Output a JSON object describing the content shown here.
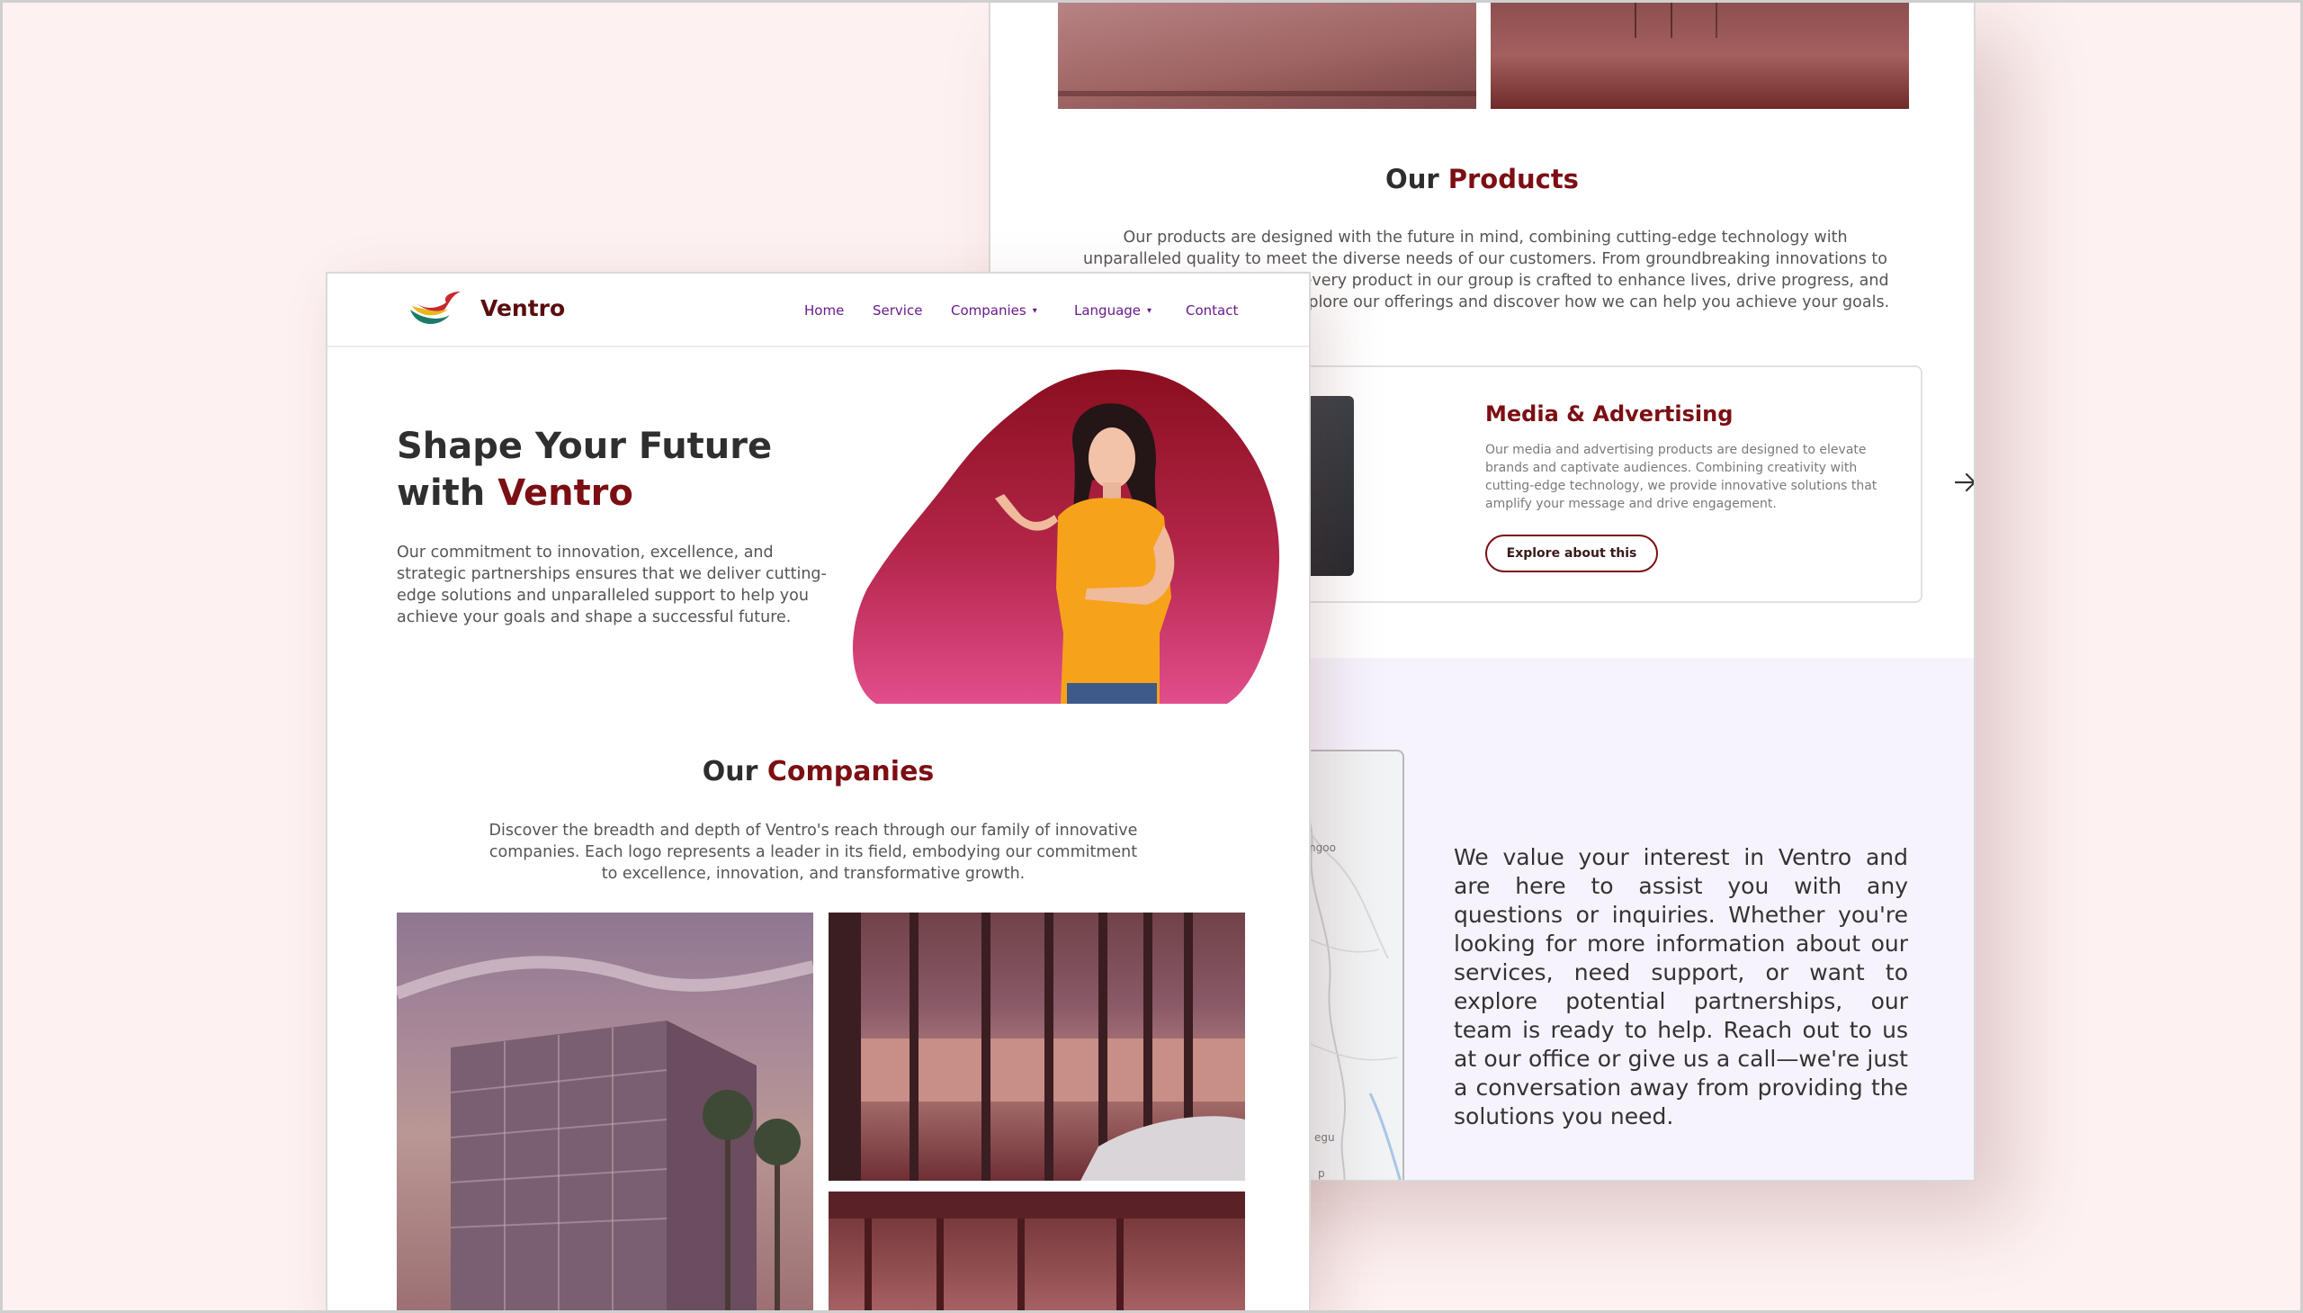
{
  "colors": {
    "background": "#fdf1f1",
    "accent": "#7c0f13",
    "nav_link": "#6a1b8a",
    "contact_bg": "#f6f3fd"
  },
  "front": {
    "brand": "Ventro",
    "nav": {
      "home": "Home",
      "service": "Service",
      "companies": "Companies",
      "language": "Language",
      "contact": "Contact"
    },
    "hero": {
      "title_line1": "Shape Your Future",
      "title_line2_prefix": "with ",
      "title_line2_accent": "Ventro",
      "description": "Our commitment to innovation, excellence, and strategic partnerships ensures that we deliver cutting-edge solutions and unparalleled support to help you achieve your goals and shape a successful future."
    },
    "companies": {
      "title_prefix": "Our ",
      "title_accent": "Companies",
      "description": "Discover the breadth and depth of Ventro's reach through our family of innovative companies. Each logo represents a leader in its field, embodying our commitment to excellence, innovation, and transformative growth."
    }
  },
  "back": {
    "products": {
      "title_prefix": "Our ",
      "title_accent": "Products",
      "description": "Our products are designed with the future in mind, combining cutting-edge technology with unparalleled quality to meet the diverse needs of our customers. From groundbreaking innovations to trusted everyday solutions, every product in our group is crafted to enhance lives, drive progress, and deliver exceptional value. Explore our offerings and discover how we can help you achieve your goals."
    },
    "card": {
      "title": "Media & Advertising",
      "description": "Our media and advertising products are designed to elevate brands and captivate audiences. Combining creativity with cutting-edge technology, we provide innovative solutions that amplify your message and drive engagement.",
      "button": "Explore about this"
    },
    "map": {
      "label_1": "ngoo",
      "label_2": "egu",
      "label_3": "p"
    },
    "contact_text": "We value your interest in Ventro and are here to assist you with any questions or inquiries. Whether you're looking for more information about our services, need support, or want to explore potential partnerships, our team is ready to help. Reach out to us at our office or give us a call—we're just a conversation away from providing the solutions you need."
  }
}
